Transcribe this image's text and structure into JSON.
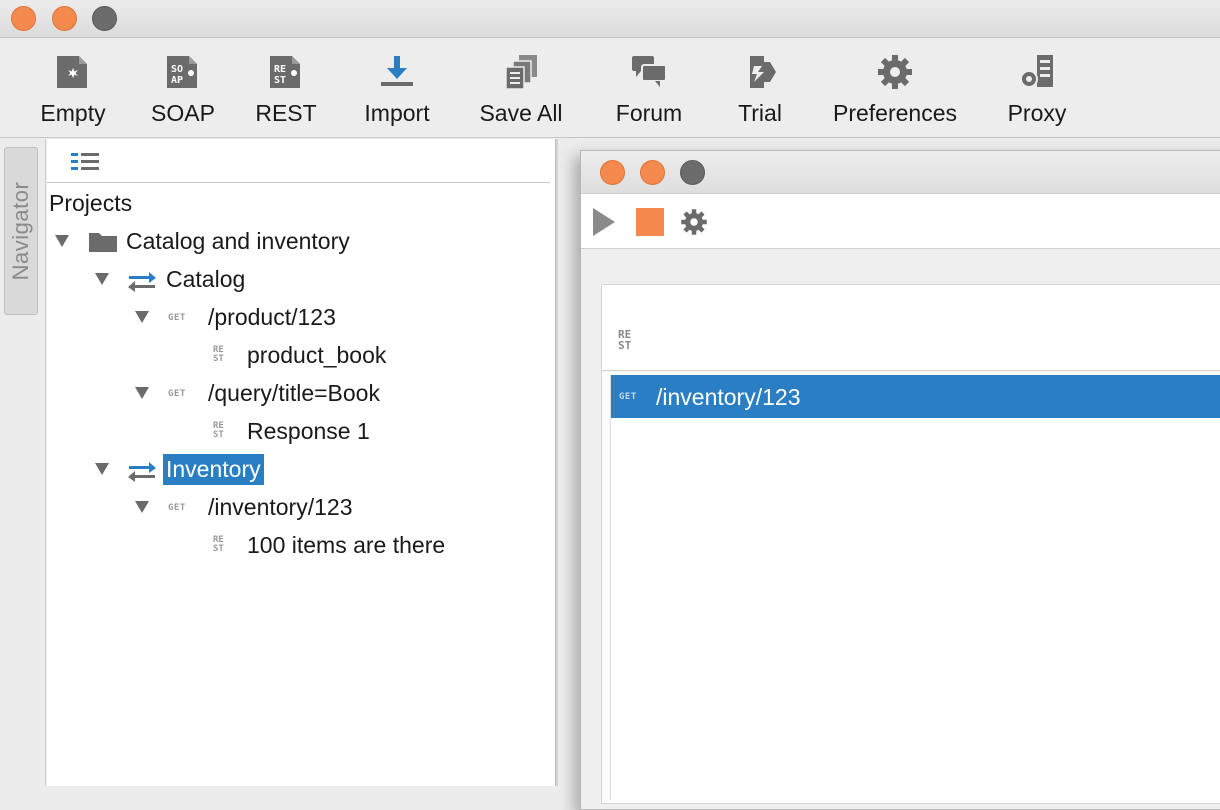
{
  "toolbar": {
    "buttons": [
      {
        "label": "Empty",
        "icon": "empty-project-icon"
      },
      {
        "label": "SOAP",
        "icon": "soap-project-icon",
        "glyph": "SO\nAP"
      },
      {
        "label": "REST",
        "icon": "rest-project-icon",
        "glyph": "RE\nST"
      },
      {
        "label": "Import",
        "icon": "import-icon"
      },
      {
        "label": "Save All",
        "icon": "save-all-icon"
      },
      {
        "label": "Forum",
        "icon": "forum-icon"
      },
      {
        "label": "Trial",
        "icon": "trial-icon"
      },
      {
        "label": "Preferences",
        "icon": "gear-icon"
      },
      {
        "label": "Proxy",
        "icon": "proxy-icon"
      }
    ]
  },
  "navigator": {
    "tab_label": "Navigator"
  },
  "tree": {
    "root_label": "Projects",
    "project": "Catalog and inventory",
    "services": [
      {
        "name": "Catalog",
        "resources": [
          {
            "method": "GET",
            "path": "/product/123",
            "response": "product_book"
          },
          {
            "method": "GET",
            "path": "/query/title=Book",
            "response": "Response 1"
          }
        ]
      },
      {
        "name": "Inventory",
        "selected": true,
        "resources": [
          {
            "method": "GET",
            "path": "/inventory/123",
            "response": "100 items are there"
          }
        ]
      }
    ]
  },
  "inner_window": {
    "header_tag": "RE\nST",
    "selected_row": {
      "method": "GET",
      "path": "/inventory/123"
    }
  },
  "colors": {
    "accent": "#2a7fc4",
    "traffic_light": "#f48a4e",
    "stop": "#f48a4e",
    "icon_gray": "#6b6b6b"
  }
}
